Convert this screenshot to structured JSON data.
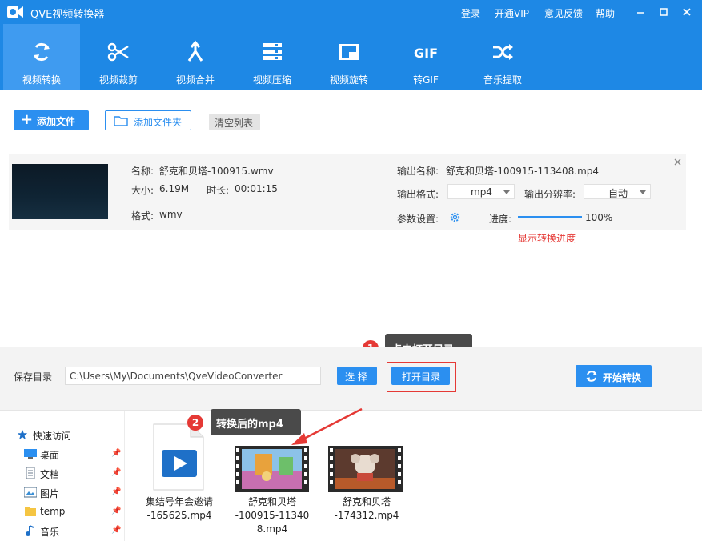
{
  "window": {
    "title": "QVE视频转换器",
    "links": [
      "登录",
      "开通VIP",
      "意见反馈",
      "帮助"
    ]
  },
  "toolbar": {
    "items": [
      {
        "label": "视频转换",
        "icon": "refresh-icon",
        "active": true
      },
      {
        "label": "视频裁剪",
        "icon": "scissors-icon",
        "active": false
      },
      {
        "label": "视频合并",
        "icon": "merge-icon",
        "active": false
      },
      {
        "label": "视频压缩",
        "icon": "compress-icon",
        "active": false
      },
      {
        "label": "视频旋转",
        "icon": "rotate-icon",
        "active": false
      },
      {
        "label": "转GIF",
        "icon": "gif-icon",
        "active": false
      },
      {
        "label": "音乐提取",
        "icon": "shuffle-icon",
        "active": false
      }
    ]
  },
  "actions": {
    "add_file": "添加文件",
    "add_folder": "添加文件夹",
    "clear_list": "清空列表"
  },
  "file": {
    "name_label": "名称:",
    "name": "舒克和贝塔-100915.wmv",
    "size_label": "大小:",
    "size": "6.19M",
    "duration_label": "时长:",
    "duration": "00:01:15",
    "format_label": "格式:",
    "format": "wmv",
    "output_name_label": "输出名称:",
    "output_name": "舒克和贝塔-100915-113408.mp4",
    "output_format_label": "输出格式:",
    "output_format": "mp4",
    "resolution_label": "输出分辨率:",
    "resolution": "自动",
    "params_label": "参数设置:",
    "progress_label": "进度:",
    "progress_text": "100%",
    "progress_value": 1.0,
    "progress_note": "显示转换进度"
  },
  "save": {
    "label": "保存目录",
    "path": "C:\\Users\\My\\Documents\\QveVideoConverter",
    "choose": "选 择",
    "open_dir": "打开目录",
    "start": "开始转换"
  },
  "callouts": {
    "one_num": "1",
    "one_text": "点击打开目录",
    "two_num": "2",
    "two_text": "转换后的mp4"
  },
  "explorer": {
    "nav": [
      {
        "label": "快速访问"
      },
      {
        "label": "桌面"
      },
      {
        "label": "文档"
      },
      {
        "label": "图片"
      },
      {
        "label": "temp"
      },
      {
        "label": "音乐"
      }
    ],
    "files": [
      {
        "line1": "集结号年会邀请",
        "line2": "-165625.mp4"
      },
      {
        "line1": "舒克和贝塔",
        "line2": "-100915-11340",
        "line3": "8.mp4"
      },
      {
        "line1": "舒克和贝塔",
        "line2": "-174312.mp4"
      }
    ]
  },
  "colors": {
    "brand": "#1e88e5",
    "accent": "#2b8ff0",
    "alert": "#e53935"
  }
}
